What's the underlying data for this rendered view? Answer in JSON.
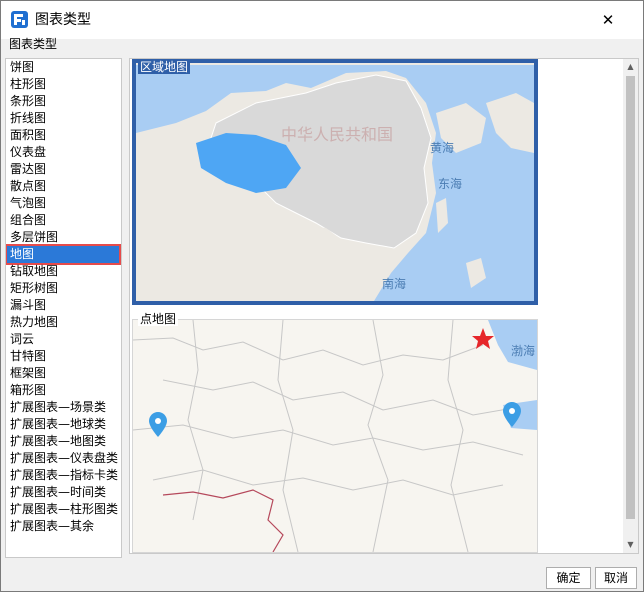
{
  "window": {
    "title": "图表类型",
    "close_icon": "close-icon"
  },
  "group": {
    "label": "图表类型"
  },
  "chart_types": [
    "饼图",
    "柱形图",
    "条形图",
    "折线图",
    "面积图",
    "仪表盘",
    "雷达图",
    "散点图",
    "气泡图",
    "组合图",
    "多层饼图",
    "地图",
    "钻取地图",
    "矩形树图",
    "漏斗图",
    "热力地图",
    "词云",
    "甘特图",
    "框架图",
    "箱形图",
    "扩展图表—场景类",
    "扩展图表—地球类",
    "扩展图表—地图类",
    "扩展图表—仪表盘类",
    "扩展图表—指标卡类",
    "扩展图表—时间类",
    "扩展图表—柱形图类",
    "扩展图表—其余"
  ],
  "selected_index": 11,
  "preview": {
    "region_map": {
      "label": "区域地图",
      "map_text": [
        "中华人民共和国",
        "黄海",
        "东海",
        "南海"
      ]
    },
    "point_map": {
      "label": "点地图",
      "map_text": [
        "渤海"
      ]
    }
  },
  "buttons": {
    "ok": "确定",
    "cancel": "取消"
  },
  "colors": {
    "selected": "#2b79d8",
    "highlight_frame": "#e64b4b",
    "region_fill": "#4ea6f4",
    "sea": "#a9cdf3",
    "land": "#d9d9d9",
    "star": "#e6262a",
    "pin": "#3c9ee5"
  }
}
